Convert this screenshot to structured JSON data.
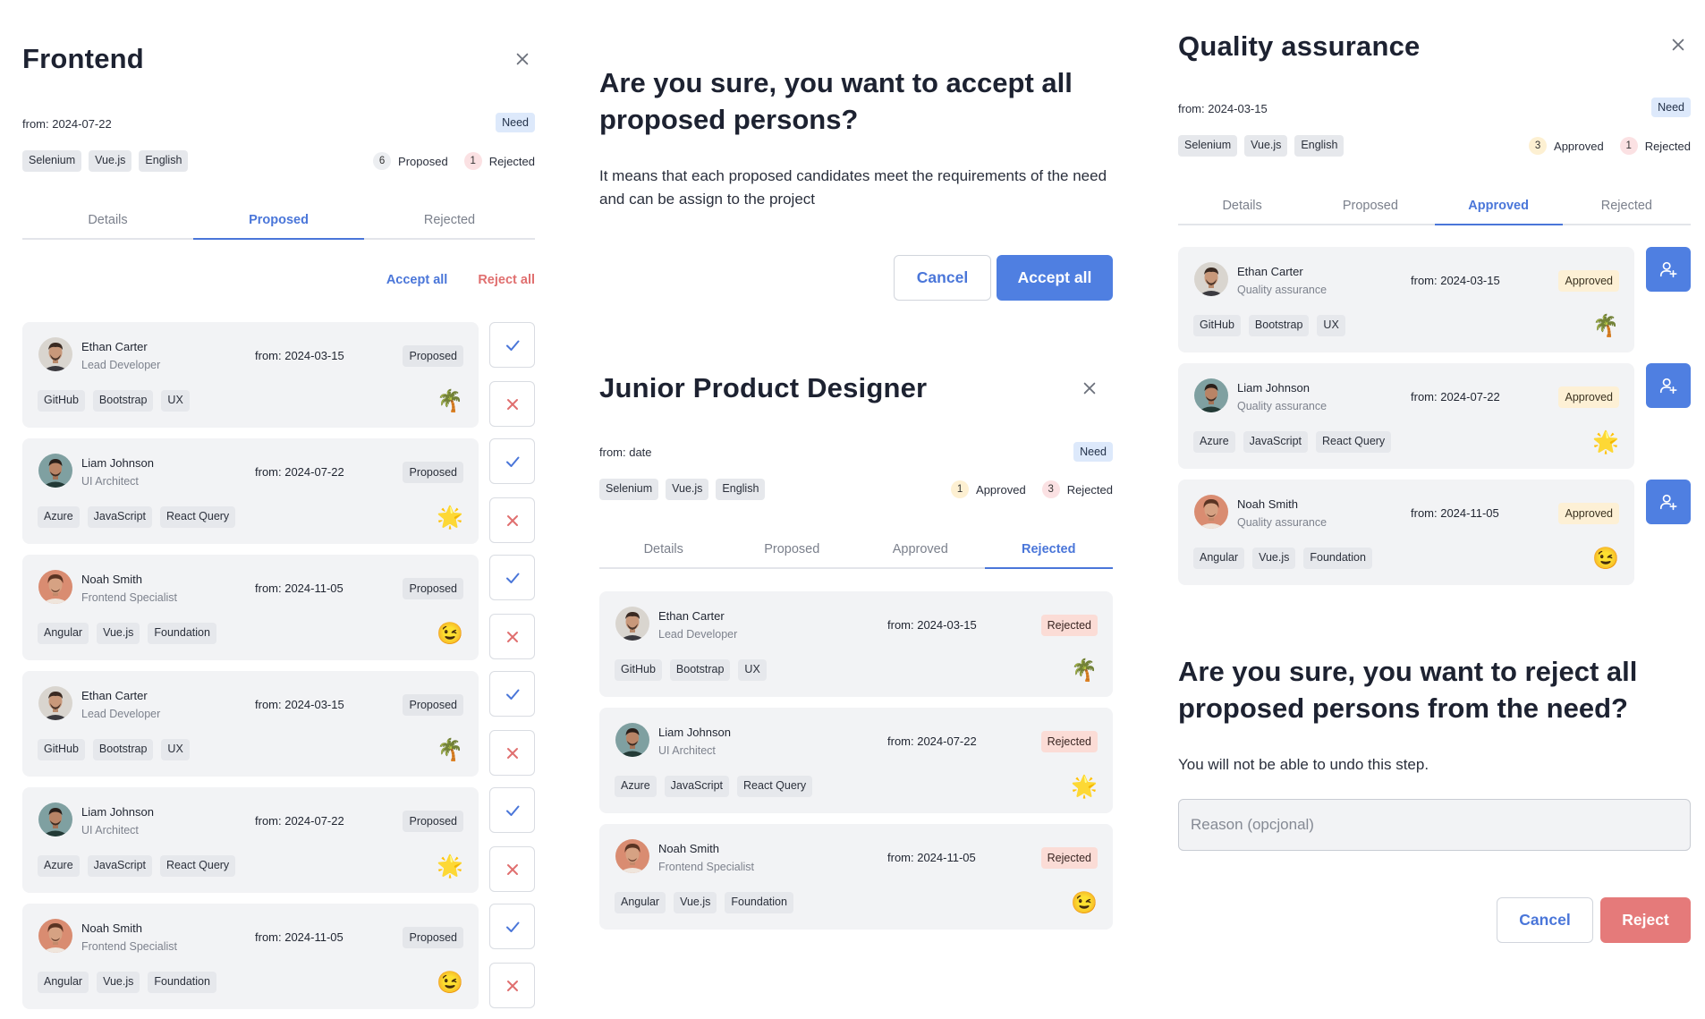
{
  "frontend": {
    "title": "Frontend",
    "from": "from: 2024-07-22",
    "need": "Need",
    "tags": [
      "Selenium",
      "Vue.js",
      "English"
    ],
    "summary": [
      {
        "count": "6",
        "label": "Proposed",
        "color": "gray"
      },
      {
        "count": "1",
        "label": "Rejected",
        "color": "pink"
      }
    ],
    "tabs": [
      "Details",
      "Proposed",
      "Rejected"
    ],
    "active_tab": "Proposed",
    "accept_all": "Accept all",
    "reject_all": "Reject all",
    "cards": [
      {
        "name": "Ethan Carter",
        "role": "Lead Developer",
        "from": "from: 2024-03-15",
        "status": "Proposed",
        "tags": [
          "GitHub",
          "Bootstrap",
          "UX"
        ],
        "emoji": "🌴",
        "avatar": "ethan"
      },
      {
        "name": "Liam Johnson",
        "role": "UI Architect",
        "from": "from: 2024-07-22",
        "status": "Proposed",
        "tags": [
          "Azure",
          "JavaScript",
          "React Query"
        ],
        "emoji": "🌟",
        "avatar": "liam"
      },
      {
        "name": "Noah Smith",
        "role": "Frontend Specialist",
        "from": "from: 2024-11-05",
        "status": "Proposed",
        "tags": [
          "Angular",
          "Vue.js",
          "Foundation"
        ],
        "emoji": "😉",
        "avatar": "noah"
      },
      {
        "name": "Ethan Carter",
        "role": "Lead Developer",
        "from": "from: 2024-03-15",
        "status": "Proposed",
        "tags": [
          "GitHub",
          "Bootstrap",
          "UX"
        ],
        "emoji": "🌴",
        "avatar": "ethan"
      },
      {
        "name": "Liam Johnson",
        "role": "UI Architect",
        "from": "from: 2024-07-22",
        "status": "Proposed",
        "tags": [
          "Azure",
          "JavaScript",
          "React Query"
        ],
        "emoji": "🌟",
        "avatar": "liam"
      },
      {
        "name": "Noah Smith",
        "role": "Frontend Specialist",
        "from": "from: 2024-11-05",
        "status": "Proposed",
        "tags": [
          "Angular",
          "Vue.js",
          "Foundation"
        ],
        "emoji": "😉",
        "avatar": "noah"
      }
    ]
  },
  "accept_dialog": {
    "title": "Are you sure, you want to accept all proposed persons?",
    "body": "It means that each proposed candidates meet the requirements of the need and can be assign to the project",
    "cancel": "Cancel",
    "confirm": "Accept all"
  },
  "junior": {
    "title": "Junior Product Designer",
    "from": "from: date",
    "need": "Need",
    "tags": [
      "Selenium",
      "Vue.js",
      "English"
    ],
    "summary": [
      {
        "count": "1",
        "label": "Approved",
        "color": "yellow"
      },
      {
        "count": "3",
        "label": "Rejected",
        "color": "pink"
      }
    ],
    "tabs": [
      "Details",
      "Proposed",
      "Approved",
      "Rejected"
    ],
    "active_tab": "Rejected",
    "cards": [
      {
        "name": "Ethan Carter",
        "role": "Lead Developer",
        "from": "from: 2024-03-15",
        "status": "Rejected",
        "tags": [
          "GitHub",
          "Bootstrap",
          "UX"
        ],
        "emoji": "🌴",
        "avatar": "ethan"
      },
      {
        "name": "Liam Johnson",
        "role": "UI Architect",
        "from": "from: 2024-07-22",
        "status": "Rejected",
        "tags": [
          "Azure",
          "JavaScript",
          "React Query"
        ],
        "emoji": "🌟",
        "avatar": "liam"
      },
      {
        "name": "Noah Smith",
        "role": "Frontend Specialist",
        "from": "from: 2024-11-05",
        "status": "Rejected",
        "tags": [
          "Angular",
          "Vue.js",
          "Foundation"
        ],
        "emoji": "😉",
        "avatar": "noah"
      }
    ]
  },
  "qa": {
    "title": "Quality assurance",
    "from": "from: 2024-03-15",
    "need": "Need",
    "tags": [
      "Selenium",
      "Vue.js",
      "English"
    ],
    "summary": [
      {
        "count": "3",
        "label": "Approved",
        "color": "yellow"
      },
      {
        "count": "1",
        "label": "Rejected",
        "color": "pink"
      }
    ],
    "tabs": [
      "Details",
      "Proposed",
      "Approved",
      "Rejected"
    ],
    "active_tab": "Approved",
    "cards": [
      {
        "name": "Ethan Carter",
        "role": "Quality assurance",
        "from": "from: 2024-03-15",
        "status": "Approved",
        "tags": [
          "GitHub",
          "Bootstrap",
          "UX"
        ],
        "emoji": "🌴",
        "avatar": "ethan"
      },
      {
        "name": "Liam Johnson",
        "role": "Quality assurance",
        "from": "from: 2024-07-22",
        "status": "Approved",
        "tags": [
          "Azure",
          "JavaScript",
          "React Query"
        ],
        "emoji": "🌟",
        "avatar": "liam"
      },
      {
        "name": "Noah Smith",
        "role": "Quality assurance",
        "from": "from: 2024-11-05",
        "status": "Approved",
        "tags": [
          "Angular",
          "Vue.js",
          "Foundation"
        ],
        "emoji": "😉",
        "avatar": "noah"
      }
    ]
  },
  "reject_dialog": {
    "title": "Are you sure, you want to reject all proposed persons from the need?",
    "body": "You will not be able to undo this step.",
    "reason_placeholder": "Reason (opcjonal)",
    "cancel": "Cancel",
    "confirm": "Reject"
  },
  "colors": {
    "accent": "#4a76d9",
    "primary_button": "#4f7fe1",
    "danger": "#e06f6f",
    "reject_button": "#e57a7a",
    "card_bg": "#f2f3f5"
  }
}
